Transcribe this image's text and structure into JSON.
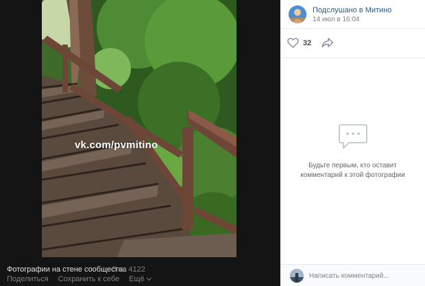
{
  "photo": {
    "watermark": "vk.com/pvmitino"
  },
  "footer": {
    "album_title": "Фотографии на стене сообщества",
    "counter": "5 из 4122",
    "share": "Поделиться",
    "save": "Сохранить к себе",
    "more": "Ещё"
  },
  "post": {
    "group_name": "Подслушано в Митино",
    "date": "14 июл в 16:04",
    "likes": "32"
  },
  "comments": {
    "empty_text": "Будьте первым, кто оставит комментарий к этой фотографии",
    "placeholder": "Написать комментарий..."
  },
  "icons": {
    "like": "heart-icon",
    "share": "share-arrow-icon",
    "empty": "comment-bubble-icon",
    "more": "chevron-down-icon"
  },
  "colors": {
    "viewer_bg": "#141414",
    "link": "#2a5885",
    "muted": "#828282"
  }
}
